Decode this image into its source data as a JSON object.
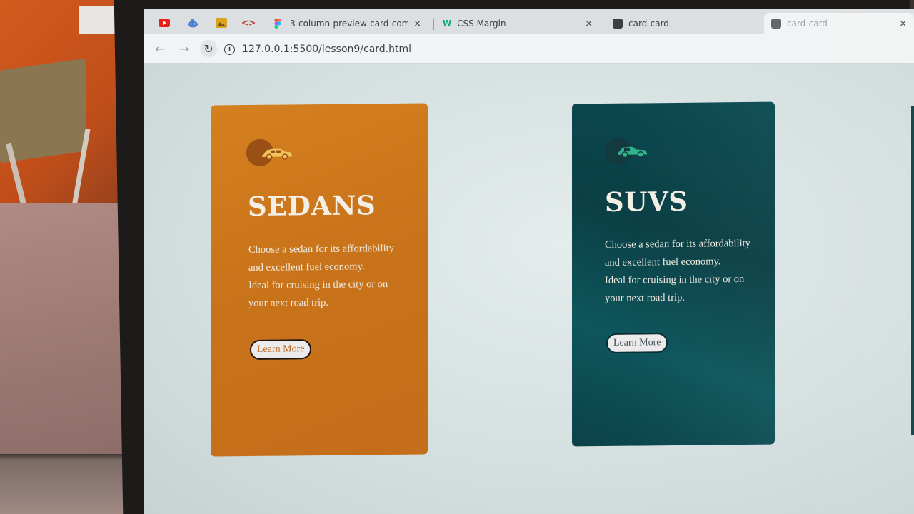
{
  "browser": {
    "tabs": [
      {
        "title": "3-column-preview-card-compon",
        "favicon": "figma-icon",
        "close": "×"
      },
      {
        "title": "CSS Margin",
        "favicon": "w3schools-icon",
        "close": "×"
      },
      {
        "title": "card-card",
        "favicon": "page-icon",
        "close": ""
      },
      {
        "title": "card-card",
        "favicon": "page-icon",
        "close": "×"
      }
    ],
    "pinned_icons": [
      "youtube-icon",
      "reddit-icon",
      "image-icon",
      "code-icon"
    ],
    "url": "127.0.0.1:5500/lesson9/card.html"
  },
  "cards": [
    {
      "title": "SEDANS",
      "text_line1": "Choose a sedan for its affordability and excellent fuel economy.",
      "text_line2": "Ideal for cruising in the city or on your next road trip.",
      "button": "Learn More",
      "color": "#c8721a",
      "icon_color": "#f0c45a"
    },
    {
      "title": "SUVS",
      "text_line1": "Choose a sedan for its affordability and excellent fuel economy.",
      "text_line2": "Ideal for cruising in the city or on your next road trip.",
      "button": "Learn More",
      "color": "#0c4b52",
      "icon_color": "#2fb58e"
    }
  ]
}
